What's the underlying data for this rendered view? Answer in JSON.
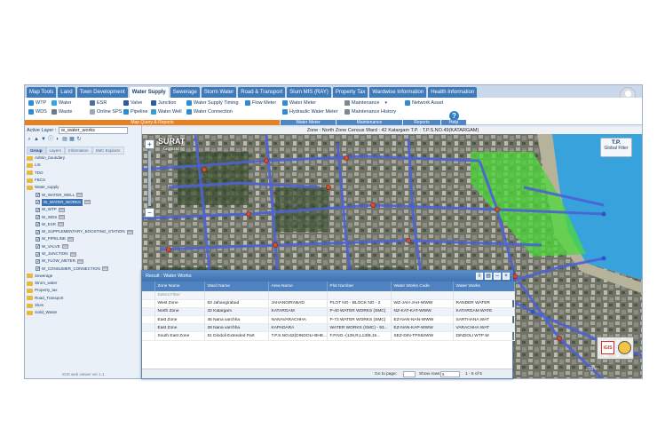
{
  "nav": {
    "tabs": [
      {
        "label": "Map Tools",
        "active": false
      },
      {
        "label": "Land",
        "active": false
      },
      {
        "label": "Town Development",
        "active": false
      },
      {
        "label": "Water Supply",
        "active": true
      },
      {
        "label": "Sewerage",
        "active": false
      },
      {
        "label": "Storm Water",
        "active": false
      },
      {
        "label": "Road & Transport",
        "active": false
      },
      {
        "label": "Slum MIS (RAY)",
        "active": false
      },
      {
        "label": "Property Tax",
        "active": false
      },
      {
        "label": "Wardwise Information",
        "active": false
      },
      {
        "label": "Health Information",
        "active": false
      }
    ]
  },
  "ribbon": {
    "items": {
      "wtp": "WTP",
      "wds": "WDS",
      "water": "Water",
      "waste": "Waste",
      "esr": "ESR",
      "online_sps": "Online SPS",
      "valve": "Valve",
      "pipeline": "Pipeline",
      "junction": "Junction",
      "water_well": "Water Well",
      "water_supply_timing": "Water Supply Timing",
      "water_connection": "Water Connection",
      "flow_meter": "Flow Meter",
      "water_meter": "Water Meter",
      "hydraulic_water_meter": "Hydraulic Water Meter",
      "maintenance": "Maintenance",
      "maintenance_history": "Maintenance History",
      "network_asset": "Network Asset"
    },
    "groups": {
      "map_query": "Map Query & Reports",
      "water_meter": "Water Meter",
      "maintenance": "Maintenance",
      "reports": "Reports",
      "help": "Help"
    },
    "help_glyph": "?"
  },
  "status": {
    "text": "Zone : North Zone   Census Ward : 42 Katargam   T.P. : T.P.S.NO.49(KATARGAM)"
  },
  "sidebar": {
    "active_layer_label": "Active Layer :",
    "active_layer_value": "w_water_works",
    "tree_tabs": [
      "Group",
      "Layers",
      "Information",
      "SMC Explorer"
    ],
    "tree": [
      {
        "label": "Admin_boundary",
        "type": "folder",
        "indent": 0
      },
      {
        "label": "LIS",
        "type": "folder",
        "indent": 0
      },
      {
        "label": "TDO",
        "type": "folder",
        "indent": 0
      },
      {
        "label": "FBCS",
        "type": "folder",
        "indent": 0
      },
      {
        "label": "Water_supply",
        "type": "folder",
        "indent": 0
      },
      {
        "label": "W_WATER_WELL",
        "type": "layer",
        "indent": 1
      },
      {
        "label": "W_WATER_WORKS",
        "type": "layer",
        "indent": 1,
        "selected": true
      },
      {
        "label": "W_WTP",
        "type": "layer",
        "indent": 1
      },
      {
        "label": "W_WDS",
        "type": "layer",
        "indent": 1
      },
      {
        "label": "W_ESR",
        "type": "layer",
        "indent": 1
      },
      {
        "label": "W_SUPPLEMENTARY_BOOSTING_STATION",
        "type": "layer",
        "indent": 1
      },
      {
        "label": "W_PIPELINE",
        "type": "layer",
        "indent": 1
      },
      {
        "label": "W_VALVE",
        "type": "layer",
        "indent": 1
      },
      {
        "label": "W_JUNCTION",
        "type": "layer",
        "indent": 1
      },
      {
        "label": "W_FLOW_METER",
        "type": "layer",
        "indent": 1
      },
      {
        "label": "W_CONSUMER_CONNECTION",
        "type": "layer",
        "indent": 1
      },
      {
        "label": "Sewerage",
        "type": "folder",
        "indent": 0
      },
      {
        "label": "Strom_water",
        "type": "folder",
        "indent": 0
      },
      {
        "label": "Property_tax",
        "type": "folder",
        "indent": 0
      },
      {
        "label": "Road_Transport",
        "type": "folder",
        "indent": 0
      },
      {
        "label": "Slum",
        "type": "folder",
        "indent": 0
      },
      {
        "label": "Solid_Waste",
        "type": "folder",
        "indent": 0
      }
    ],
    "version": "iGIS web viewer ver 1.1"
  },
  "map": {
    "city": "SURAT",
    "state": "Gujarat",
    "tp_title": "T.P.",
    "tp_sub": "Global Filter",
    "zoom_in": "+",
    "zoom_out": "−",
    "logo_text": "iGIS",
    "scale_text": "200 m"
  },
  "result": {
    "title": "Result : Water Works",
    "columns": [
      "",
      "Zone Name",
      "Ward Name",
      "Area Name",
      "Plot Number",
      "Water Works Code",
      "Water Works"
    ],
    "filter_placeholder": "Select Filter",
    "rows": [
      [
        "",
        "West Zone",
        "63 Jahangirabad",
        "JAHANGIRABAD",
        "PLOT NO - BLOCK NO - 2",
        "WZ-JAH-JAH-WWW",
        "RANDER WATER"
      ],
      [
        "",
        "North Zone",
        "42 Katargam",
        "KATARGAM",
        "P-40 WATER WORKS (SMC)",
        "NZ-KAT-KAT-WWW",
        "KATARGAM WATE"
      ],
      [
        "",
        "East Zone",
        "45 Nana varchha",
        "NANAVARACHHA",
        "P-73 WATER WORKS (SMC)",
        "EZ-NAN-NAN-WWW",
        "SARTHANA WAT"
      ],
      [
        "",
        "East Zone",
        "28 Nana varchha",
        "KAPADARA",
        "WATER WORKS (SMC) - 93...",
        "EZ-NAN-KAP-WWW",
        "VARACHHA WAT"
      ],
      [
        "",
        "South East Zone",
        "81 Dindoli Extended Part",
        "T.P.S.NO.62(DINDOLI-BHE...",
        "F.P.NO.-(139,R,L13/B,15...",
        "SEZ-DIN-TPS62WW",
        "DINDOLI WTP W"
      ]
    ],
    "footer": {
      "goto_label": "Go to page:",
      "show_label": "Show rows:",
      "show_value": "5",
      "page_info": "1 - 5 of 5"
    }
  }
}
